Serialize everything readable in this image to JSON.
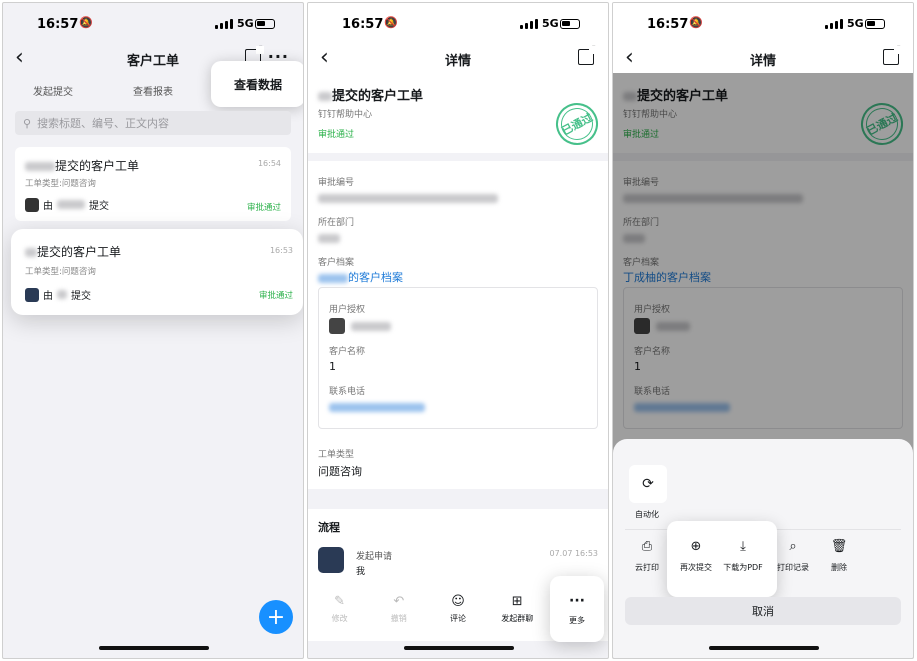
{
  "status": {
    "time": "16:57",
    "network": "5G"
  },
  "screen1": {
    "title": "客户工单",
    "tabs": [
      "发起提交",
      "查看报表"
    ],
    "popover": "查看数据",
    "search_placeholder": "搜索标题、编号、正文内容",
    "cards": [
      {
        "title": "提交的客户工单",
        "time": "16:54",
        "sub": "工单类型:问题咨询",
        "by": "由",
        "by_suffix": "提交",
        "status": "审批通过"
      },
      {
        "title": "提交的客户工单",
        "time": "16:53",
        "sub": "工单类型:问题咨询",
        "by": "由",
        "by_suffix": "提交",
        "status": "审批通过"
      }
    ],
    "fab": "+"
  },
  "screen2": {
    "title": "详情",
    "doc_title": "提交的客户工单",
    "org": "钉钉帮助中心",
    "status": "审批通过",
    "seal": "已通过",
    "fields": {
      "approval_no": "审批编号",
      "dept": "所在部门",
      "archive": "客户档案",
      "archive_suffix": "的客户档案",
      "user_auth": "用户授权",
      "cust_name": "客户名称",
      "cust_name_val": "1",
      "phone": "联系电话",
      "type": "工单类型",
      "type_val": "问题咨询"
    },
    "flow": {
      "title": "流程",
      "step": "发起申请",
      "who": "我",
      "time": "07.07 16:53"
    },
    "toolbar": [
      "修改",
      "撤销",
      "评论",
      "发起群聊"
    ],
    "more": "更多"
  },
  "screen3": {
    "title": "详情",
    "doc_title": "提交的客户工单",
    "archive_val": "丁成柚的客户档案",
    "auto": "自动化",
    "actions": [
      "云打印",
      "再次提交",
      "下载为PDF",
      "打印记录",
      "删除"
    ],
    "cancel": "取消"
  }
}
